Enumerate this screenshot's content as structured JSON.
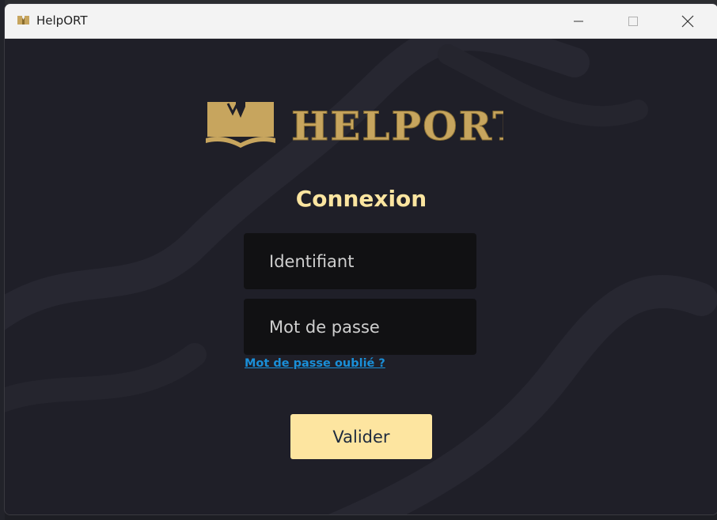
{
  "window": {
    "title": "HelpORT",
    "controls": [
      "minimize",
      "maximize",
      "close"
    ]
  },
  "logo": {
    "text": "HELPORT",
    "icon": "open-book-icon",
    "color": "#c7a55e"
  },
  "login": {
    "heading": "Connexion",
    "username_placeholder": "Identifiant",
    "password_placeholder": "Mot de passe",
    "forgot_link": "Mot de passe oublié ?",
    "submit_label": "Valider"
  },
  "colors": {
    "background": "#1f1f28",
    "heading": "#fbe5a0",
    "input_bg": "#111113",
    "link": "#1a8fd8",
    "button_bg": "#fde5a0",
    "button_text": "#1e2a3e"
  }
}
